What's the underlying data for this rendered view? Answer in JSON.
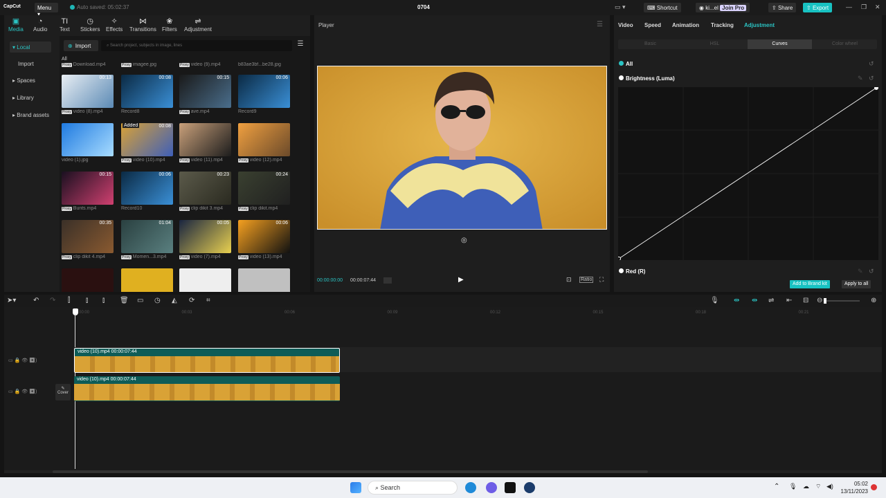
{
  "titlebar": {
    "brand": "CapCut",
    "menu": "Menu",
    "autosave": "Auto saved: 05:02:37",
    "project": "0704",
    "shortcut": "Shortcut",
    "user": "ki...el",
    "joinpro": "Join Pro",
    "share": "Share",
    "export": "Export"
  },
  "media_tabs": [
    "Media",
    "Audio",
    "Text",
    "Stickers",
    "Effects",
    "Transitions",
    "Filters",
    "Adjustment"
  ],
  "sidebar": [
    "Local",
    "Import",
    "Spaces",
    "Library",
    "Brand assets"
  ],
  "media": {
    "import": "Import",
    "search_placeholder": "Search project, subjects in image, lines",
    "all": "All",
    "top_labels": [
      "Download.mp4",
      "imagee.jpg",
      "video (9).mp4",
      "b83ae3bf...be28.jpg"
    ],
    "items": [
      {
        "label": "video (8).mp4",
        "dur": "00:13",
        "proxy": true
      },
      {
        "label": "Record8",
        "dur": "00:08",
        "proxy": false
      },
      {
        "label": "ave.mp4",
        "dur": "00:15",
        "proxy": true
      },
      {
        "label": "Record9",
        "dur": "00:06",
        "proxy": false
      },
      {
        "label": "video (1).jpg",
        "dur": "",
        "proxy": false
      },
      {
        "label": "video (10).mp4",
        "dur": "00:08",
        "proxy": true,
        "added": "Added"
      },
      {
        "label": "video (11).mp4",
        "dur": "",
        "proxy": true
      },
      {
        "label": "video (12).mp4",
        "dur": "",
        "proxy": true
      },
      {
        "label": "Bunts.mp4",
        "dur": "00:15",
        "proxy": true
      },
      {
        "label": "Record10",
        "dur": "00:06",
        "proxy": false
      },
      {
        "label": "clip dikit 3.mp4",
        "dur": "00:23",
        "proxy": true
      },
      {
        "label": "clip dikit.mp4",
        "dur": "00:24",
        "proxy": true
      },
      {
        "label": "clip dikit 4.mp4",
        "dur": "00:35",
        "proxy": true
      },
      {
        "label": "Momen...3.mp4",
        "dur": "01:04",
        "proxy": true
      },
      {
        "label": "video (7).mp4",
        "dur": "00:05",
        "proxy": true
      },
      {
        "label": "video (13).mp4",
        "dur": "00:06",
        "proxy": true
      }
    ]
  },
  "player": {
    "title": "Player",
    "current": "00:00:00:00",
    "total": "00:00:07:44",
    "ratio": "Ratio"
  },
  "right": {
    "tabs": [
      "Video",
      "Speed",
      "Animation",
      "Tracking",
      "Adjustment"
    ],
    "subtabs": [
      "Basic",
      "HSL",
      "Curves",
      "Color wheel"
    ],
    "all": "All",
    "luma": "Brightness (Luma)",
    "red": "Red (R)",
    "brandkit": "Add to Brand kit",
    "applyall": "Apply to all"
  },
  "ruler": [
    "00:00",
    "00:03",
    "00:06",
    "00:09",
    "00:12",
    "00:15",
    "00:18",
    "00:21"
  ],
  "tracks": {
    "clip1": "video (10).mp4   00:00:07:44",
    "clip2": "video (10).mp4   00:00:07:44",
    "cover": "Cover"
  },
  "taskbar": {
    "search": "Search",
    "time": "05:02",
    "date": "13/11/2023"
  }
}
